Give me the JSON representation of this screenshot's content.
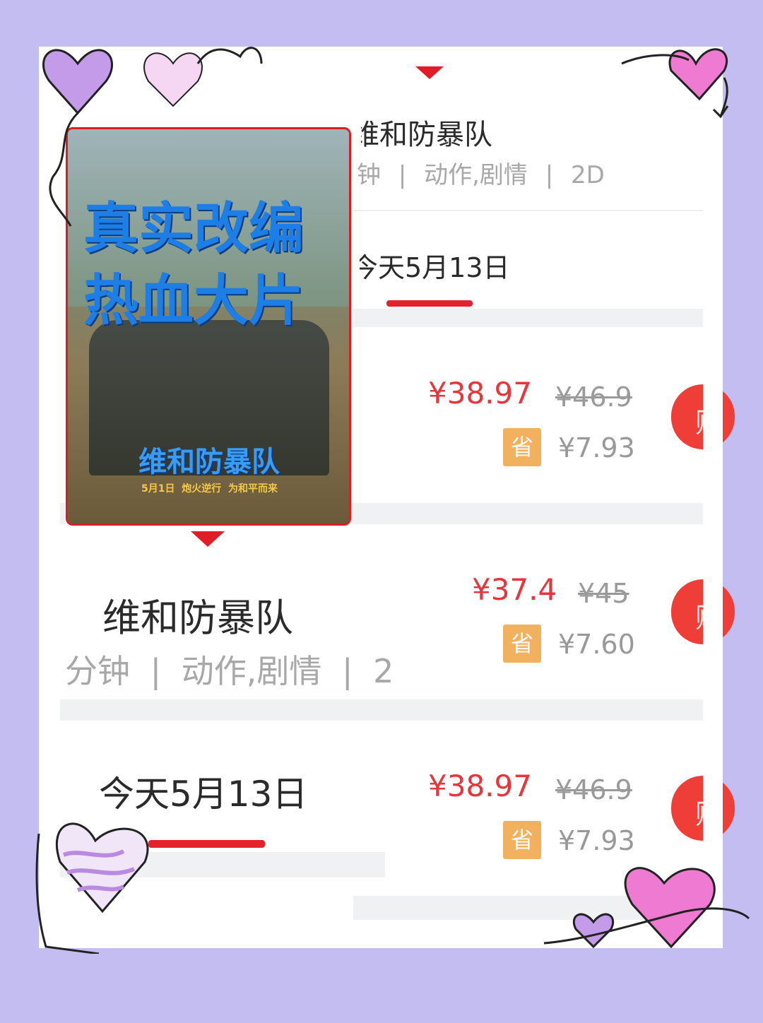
{
  "movie": {
    "title": "维和防暴队",
    "title_partial": "维和防暴队",
    "meta_duration": "分钟",
    "meta_duration_partial": "钟",
    "meta_genre": "动作,剧情",
    "meta_format": "2D",
    "meta_format_partial": "2D",
    "separator": "|"
  },
  "date_tab": {
    "label": "今天5月13日",
    "label_partial": "今天5月13日"
  },
  "poster": {
    "headline_line1": "真实改编",
    "headline_line2": "热血大片",
    "poster_title": "维和防暴队",
    "tagline": "5月1日  炮火逆行  为和平而来"
  },
  "showtimes": [
    {
      "price": "¥38.97",
      "original_price": "¥46.9",
      "save_label": "省",
      "save_amount": "¥7.93",
      "buy_label": "购"
    },
    {
      "price": "¥37.4",
      "original_price": "¥45",
      "save_label": "省",
      "save_amount": "¥7.60",
      "buy_label": "购"
    },
    {
      "price": "¥38.97",
      "original_price": "¥46.9",
      "save_label": "省",
      "save_amount": "¥7.93",
      "buy_label": "购"
    }
  ],
  "colors": {
    "background": "#c3bdf2",
    "accent_red": "#e8343a",
    "save_badge": "#f2b15f",
    "poster_headline": "#1d7fe6"
  },
  "icons": [
    "heart-doodle-icon",
    "dropdown-triangle-icon"
  ]
}
